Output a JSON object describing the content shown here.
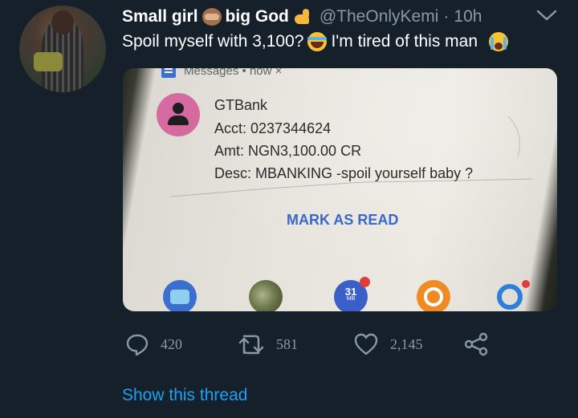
{
  "tweet": {
    "display_name_part1": "Small girl",
    "display_name_part2": "big God",
    "handle": "@TheOnlyKemi",
    "separator": "·",
    "time": "10h",
    "text_part1": "Spoil myself with 3,100?",
    "text_part2": "I'm tired of this man",
    "emojis": [
      "see-no-evil-monkey",
      "flexed-biceps",
      "face-with-tears-of-joy",
      "loudly-crying-face"
    ]
  },
  "photo": {
    "app_header": "Messages • now ×",
    "sender": "GTBank",
    "acct": "Acct: 0237344624",
    "amt": "Amt: NGN3,100.00 CR",
    "desc": "Desc: MBANKING -spoil yourself baby ?",
    "action": "MARK AS READ",
    "calendar_day": "31",
    "calendar_sub": "MB"
  },
  "actions": {
    "replies": "420",
    "retweets": "581",
    "likes": "2,145"
  },
  "footer": {
    "show_thread": "Show this thread"
  },
  "colors": {
    "background": "#15202b",
    "secondary_text": "#8899a6",
    "link": "#1da1f2"
  }
}
